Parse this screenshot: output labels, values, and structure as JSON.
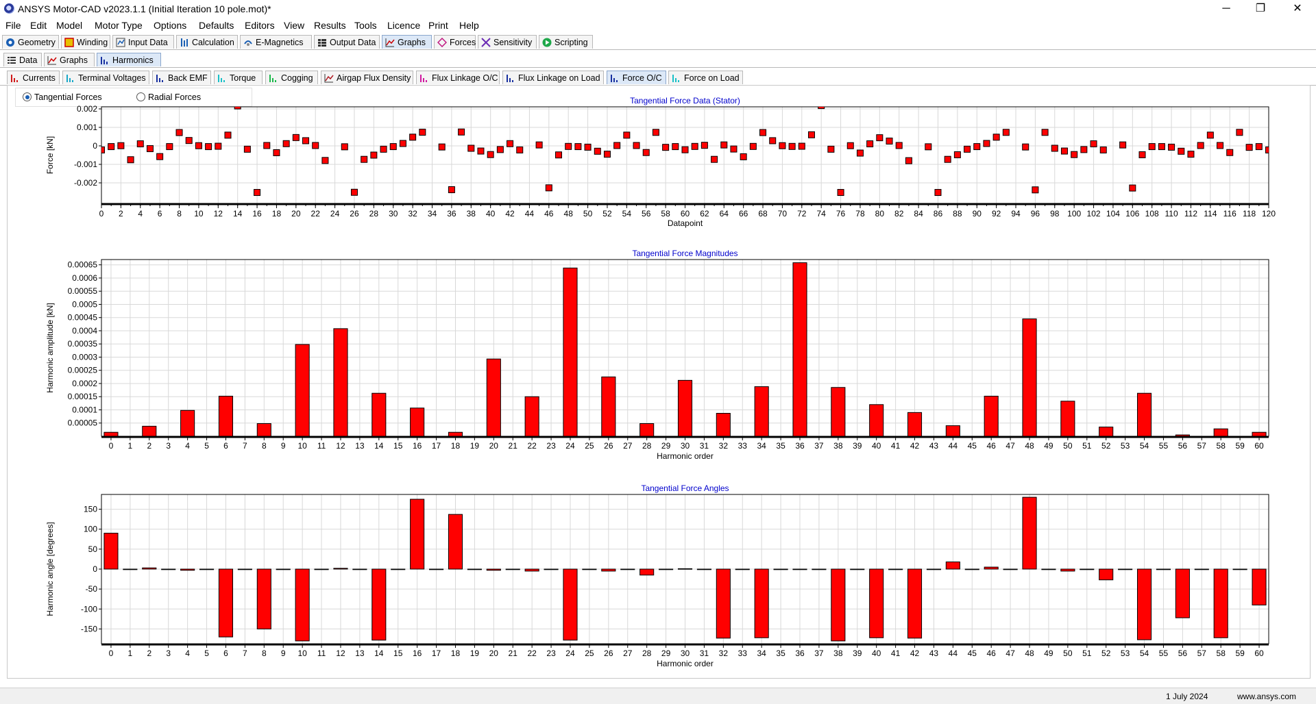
{
  "window": {
    "title": "ANSYS Motor-CAD v2023.1.1 (Initial Iteration 10 pole.mot)*",
    "controls": [
      "─",
      "❐",
      "✕"
    ]
  },
  "menu": [
    "File",
    "Edit",
    "Model",
    "Motor Type",
    "Options",
    "Defaults",
    "Editors",
    "View",
    "Results",
    "Tools",
    "Licence",
    "Print",
    "Help"
  ],
  "main_tabs": [
    {
      "label": "Geometry",
      "icon": "geometry-icon"
    },
    {
      "label": "Winding",
      "icon": "winding-icon"
    },
    {
      "label": "Input Data",
      "icon": "input-data-icon"
    },
    {
      "label": "Calculation",
      "icon": "calculation-icon"
    },
    {
      "label": "E-Magnetics",
      "icon": "emagnetics-icon"
    },
    {
      "label": "Output Data",
      "icon": "output-data-icon"
    },
    {
      "label": "Graphs",
      "icon": "graphs-icon",
      "active": true
    },
    {
      "label": "Forces",
      "icon": "forces-icon"
    },
    {
      "label": "Sensitivity",
      "icon": "sensitivity-icon"
    },
    {
      "label": "Scripting",
      "icon": "scripting-icon"
    }
  ],
  "sub_tabs": [
    {
      "label": "Data",
      "icon": "data-grid-icon"
    },
    {
      "label": "Graphs",
      "icon": "line-graph-icon"
    },
    {
      "label": "Harmonics",
      "icon": "harmonics-icon",
      "active": true
    }
  ],
  "graph_tabs": [
    {
      "label": "Currents",
      "color": "#d01818"
    },
    {
      "label": "Terminal Voltages",
      "color": "#18a8c8"
    },
    {
      "label": "Back EMF",
      "color": "#1830a0"
    },
    {
      "label": "Torque",
      "color": "#18c0c8"
    },
    {
      "label": "Cogging",
      "color": "#18b848"
    },
    {
      "label": "Airgap Flux Density",
      "color": "#b01820"
    },
    {
      "label": "Flux Linkage O/C",
      "color": "#d018a0"
    },
    {
      "label": "Flux Linkage on Load",
      "color": "#1830a0"
    },
    {
      "label": "Force O/C",
      "color": "#1830a0",
      "active": true
    },
    {
      "label": "Force on Load",
      "color": "#18c0c8"
    }
  ],
  "radios": {
    "tangential": {
      "label": "Tangential Forces",
      "checked": true
    },
    "radial": {
      "label": "Radial Forces",
      "checked": false
    }
  },
  "status": {
    "date": "1 July 2024",
    "url": "www.ansys.com"
  },
  "colors": {
    "marker": "#ff0000",
    "title": "#0000cc",
    "grid": "#d8d8d8"
  },
  "chart_data": [
    {
      "type": "scatter",
      "title": "Tangential Force Data (Stator)",
      "xlabel": "Datapoint",
      "ylabel": "Force [kN]",
      "xlim": [
        0,
        120
      ],
      "ylim": [
        -0.003,
        0.002
      ],
      "xticks": [
        0,
        2,
        4,
        6,
        8,
        10,
        12,
        14,
        16,
        18,
        20,
        22,
        24,
        26,
        28,
        30,
        32,
        34,
        36,
        38,
        40,
        42,
        44,
        46,
        48,
        50,
        52,
        54,
        56,
        58,
        60,
        62,
        64,
        66,
        68,
        70,
        72,
        74,
        76,
        78,
        80,
        82,
        84,
        86,
        88,
        90,
        92,
        94,
        96,
        98,
        100,
        102,
        104,
        106,
        108,
        110,
        112,
        114,
        116,
        118,
        120
      ],
      "yticks": [
        0.002,
        0.001,
        0,
        -0.001,
        -0.002
      ],
      "ytick_labels": [
        "0.002",
        "0.001",
        "0",
        "-0.001",
        "-0.002"
      ],
      "grid": true,
      "x": [
        0,
        1,
        2,
        3,
        4,
        5,
        6,
        7,
        8,
        9,
        10,
        11,
        12,
        13,
        14,
        15,
        16,
        17,
        18,
        19,
        20,
        21,
        22,
        23,
        24,
        25,
        26,
        27,
        28,
        29,
        30,
        31,
        32,
        33,
        34,
        35,
        36,
        37,
        38,
        39,
        40,
        41,
        42,
        43,
        44,
        45,
        46,
        47,
        48,
        49,
        50,
        51,
        52,
        53,
        54,
        55,
        56,
        57,
        58,
        59,
        60,
        61,
        62,
        63,
        64,
        65,
        66,
        67,
        68,
        69,
        70,
        71,
        72,
        73,
        74,
        75,
        76,
        77,
        78,
        79,
        80,
        81,
        82,
        83,
        84,
        85,
        86,
        87,
        88,
        89,
        90,
        91,
        92,
        93,
        94,
        95,
        96,
        97,
        98,
        99,
        100,
        101,
        102,
        103,
        104,
        105,
        106,
        107,
        108,
        109,
        110,
        111,
        112,
        113,
        114,
        115,
        116,
        117,
        118,
        119,
        120
      ],
      "y": [
        -0.00022,
        -4e-05,
        1e-05,
        -0.00075,
        0.00011,
        -0.00015,
        -0.00058,
        -4e-05,
        0.00072,
        0.00029,
        1e-05,
        -4e-05,
        -2e-05,
        0.00058,
        0.00216,
        -0.00018,
        -0.00252,
        2e-05,
        -0.00037,
        0.00012,
        0.00045,
        0.00028,
        2e-05,
        -0.00079,
        null,
        -5e-05,
        -0.00251,
        -0.00073,
        -0.0005,
        -0.00018,
        -4e-05,
        0.00013,
        0.00047,
        0.00074,
        null,
        -6e-05,
        -0.00237,
        0.00075,
        -0.00013,
        -0.00028,
        -0.00047,
        -0.0002,
        0.00012,
        -0.00022,
        null,
        5e-05,
        -0.00227,
        -0.00049,
        -3e-05,
        -4e-05,
        -7e-05,
        -0.00029,
        -0.00045,
        2e-05,
        0.00058,
        2e-05,
        -0.00036,
        0.00073,
        -8e-05,
        -4e-05,
        -0.00021,
        -3e-05,
        3e-05,
        -0.00073,
        5e-05,
        -0.00017,
        -0.00059,
        -3e-05,
        0.00072,
        0.00028,
        1e-05,
        -3e-05,
        -2e-05,
        0.0006,
        0.00218,
        -0.00018,
        -0.00252,
        1e-05,
        -0.00039,
        0.00011,
        0.00044,
        0.00026,
        2e-05,
        -0.0008,
        null,
        -5e-05,
        -0.00252,
        -0.00073,
        -0.00048,
        -0.00018,
        -4e-05,
        0.00013,
        0.00047,
        0.00073,
        null,
        -6e-05,
        -0.00238,
        0.00073,
        -0.00013,
        -0.00028,
        -0.00047,
        -0.0002,
        0.00011,
        -0.00022,
        null,
        5e-05,
        -0.00228,
        -0.00048,
        -4e-05,
        -4e-05,
        -7e-05,
        -0.00029,
        -0.00045,
        2e-05,
        0.00058,
        2e-05,
        -0.00036,
        0.00073,
        -8e-05,
        -4e-05,
        -0.00022
      ]
    },
    {
      "type": "bar",
      "title": "Tangential Force Magnitudes",
      "xlabel": "Harmonic order",
      "ylabel": "Harmonic amplitude [kN]",
      "xlim": [
        -0.5,
        60.5
      ],
      "ylim": [
        0,
        0.00067
      ],
      "yticks": [
        5e-05,
        0.0001,
        0.00015,
        0.0002,
        0.00025,
        0.0003,
        0.00035,
        0.0004,
        0.00045,
        0.0005,
        0.00055,
        0.0006,
        0.00065
      ],
      "ytick_labels": [
        "0.00005",
        "0.0001",
        "0.00015",
        "0.0002",
        "0.00025",
        "0.0003",
        "0.00035",
        "0.0004",
        "0.00045",
        "0.0005",
        "0.00055",
        "0.0006",
        "0.00065"
      ],
      "grid": true,
      "categories": [
        0,
        1,
        2,
        3,
        4,
        5,
        6,
        7,
        8,
        9,
        10,
        11,
        12,
        13,
        14,
        15,
        16,
        17,
        18,
        19,
        20,
        21,
        22,
        23,
        24,
        25,
        26,
        27,
        28,
        29,
        30,
        31,
        32,
        33,
        34,
        35,
        36,
        37,
        38,
        39,
        40,
        41,
        42,
        43,
        44,
        45,
        46,
        47,
        48,
        49,
        50,
        51,
        52,
        53,
        54,
        55,
        56,
        57,
        58,
        59,
        60
      ],
      "values": [
        1.5e-05,
        0,
        3.8e-05,
        0,
        9.8e-05,
        0,
        0.000152,
        0,
        4.8e-05,
        0,
        0.000348,
        0,
        0.000408,
        0,
        0.000163,
        0,
        0.000107,
        0,
        1.5e-05,
        0,
        0.000293,
        0,
        0.00015,
        0,
        0.000638,
        0,
        0.000225,
        0,
        4.8e-05,
        0,
        0.000212,
        0,
        8.7e-05,
        0,
        0.000188,
        0,
        0.000658,
        0,
        0.000185,
        0,
        0.00012,
        0,
        9e-05,
        0,
        4e-05,
        0,
        0.000152,
        0,
        0.000445,
        0,
        0.000133,
        0,
        3.5e-05,
        0,
        0.000163,
        0,
        5e-06,
        0,
        2.8e-05,
        0,
        1.5e-05
      ]
    },
    {
      "type": "bar",
      "title": "Tangential Force Angles",
      "xlabel": "Harmonic order",
      "ylabel": "Harmonic angle [degrees]",
      "xlim": [
        -0.5,
        60.5
      ],
      "ylim": [
        -187,
        187
      ],
      "yticks": [
        150,
        100,
        50,
        0,
        -50,
        -100,
        -150
      ],
      "ytick_labels": [
        "150",
        "100",
        "50",
        "0",
        "-50",
        "-100",
        "-150"
      ],
      "grid": true,
      "categories": [
        0,
        1,
        2,
        3,
        4,
        5,
        6,
        7,
        8,
        9,
        10,
        11,
        12,
        13,
        14,
        15,
        16,
        17,
        18,
        19,
        20,
        21,
        22,
        23,
        24,
        25,
        26,
        27,
        28,
        29,
        30,
        31,
        32,
        33,
        34,
        35,
        36,
        37,
        38,
        39,
        40,
        41,
        42,
        43,
        44,
        45,
        46,
        47,
        48,
        49,
        50,
        51,
        52,
        53,
        54,
        55,
        56,
        57,
        58,
        59,
        60
      ],
      "values": [
        90,
        0,
        3,
        0,
        -3,
        0,
        -170,
        0,
        -150,
        0,
        -180,
        0,
        2,
        0,
        -178,
        0,
        175,
        0,
        137,
        0,
        -3,
        0,
        -5,
        0,
        -178,
        0,
        -5,
        0,
        -15,
        0,
        1,
        0,
        -173,
        0,
        -172,
        0,
        0,
        0,
        -180,
        0,
        -172,
        0,
        -173,
        0,
        18,
        0,
        5,
        0,
        180,
        0,
        -5,
        0,
        -27,
        0,
        -177,
        0,
        -122,
        0,
        -172,
        0,
        -90
      ]
    }
  ]
}
